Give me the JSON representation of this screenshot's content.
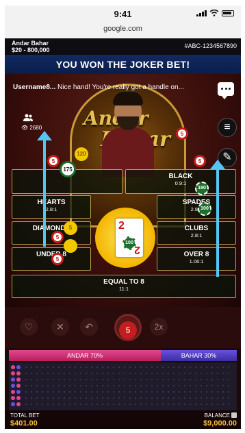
{
  "status_bar": {
    "time": "9:41"
  },
  "browser": {
    "url": "google.com"
  },
  "game": {
    "name": "Andar Bahar",
    "limits": "$20 - 800,000",
    "table_id": "#ABC-1234567890"
  },
  "banner": {
    "text": "YOU WON THE JOKER BET!"
  },
  "chat": {
    "username": "Username8...",
    "message": "Nice hand! You're really got a handle on..."
  },
  "stage": {
    "logo_top": "Andar",
    "logo_bottom": "Bahar",
    "viewers": "2680"
  },
  "bets": {
    "red": {
      "label": "",
      "odds": ""
    },
    "black": {
      "label": "BLACK",
      "odds": "0.9:1"
    },
    "hearts": {
      "label": "HEARTS",
      "odds": "2.8:1"
    },
    "spades": {
      "label": "SPADES",
      "odds": "2.8:1"
    },
    "diamonds": {
      "label": "DIAMONDS",
      "odds": ""
    },
    "clubs": {
      "label": "CLUBS",
      "odds": "2.8:1"
    },
    "under8": {
      "label": "UNDER 8",
      "odds": ""
    },
    "over8": {
      "label": "OVER 8",
      "odds": "1.06:1"
    },
    "equal8": {
      "label": "EQUAL TO 8",
      "odds": "11:1"
    }
  },
  "joker_card": {
    "rank": "2",
    "suit": "♦"
  },
  "chips": {
    "c175": "175",
    "c100": "100",
    "c5": "5",
    "c120": "120",
    "c190": "190"
  },
  "controls": {
    "chip_value": "5",
    "double": "2x",
    "undo": "↶",
    "clear": "✕",
    "favorite": "♡"
  },
  "bet_split": {
    "andar": "ANDAR 70%",
    "bahar": "BAHAR 30%",
    "andar_fraction": 0.7
  },
  "footer": {
    "total_bet_label": "TOTAL BET",
    "total_bet": "$401.00",
    "balance_label": "BALANCE",
    "balance": "$9,000.00"
  }
}
